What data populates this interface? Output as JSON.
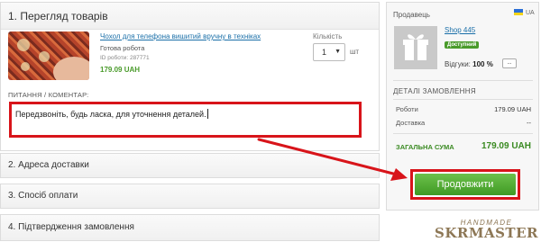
{
  "sections": {
    "s1_title": "1. Перегляд товарів",
    "s2_title": "2. Адреса доставки",
    "s3_title": "3. Спосіб оплати",
    "s4_title": "4. Підтвердження замовлення"
  },
  "product": {
    "title": "Чохол для телефона вишитий вручну в техніках",
    "status": "Готова робота",
    "id_text": "ID роботи: 287771",
    "price": "179.09 UAH",
    "qty_label": "Кількість",
    "qty_value": "1",
    "qty_unit": "шт"
  },
  "comment": {
    "label": "ПИТАННЯ / КОМЕНТАР:",
    "text": "Передзвоніть, будь ласка, для уточнення деталей."
  },
  "seller": {
    "label": "Продавець",
    "country": "UA",
    "shop_name": "Shop 445",
    "badge": "Доступний",
    "reviews_label": "Відгуки:",
    "reviews_value": "100 %",
    "more": "..."
  },
  "order": {
    "title": "ДЕТАЛІ ЗАМОВЛЕННЯ",
    "works_label": "Роботи",
    "works_value": "179.09 UAH",
    "delivery_label": "Доставка",
    "delivery_value": "--",
    "total_label": "ЗАГАЛЬНА СУМА",
    "total_value": "179.09 UAH"
  },
  "actions": {
    "proceed": "Продовжити"
  },
  "watermark": {
    "line1": "HANDMADE",
    "line2": "SKRMASTER"
  },
  "colors": {
    "highlight": "#d8141a",
    "accent_green": "#4a9b2b",
    "link_blue": "#1a6fa8"
  }
}
